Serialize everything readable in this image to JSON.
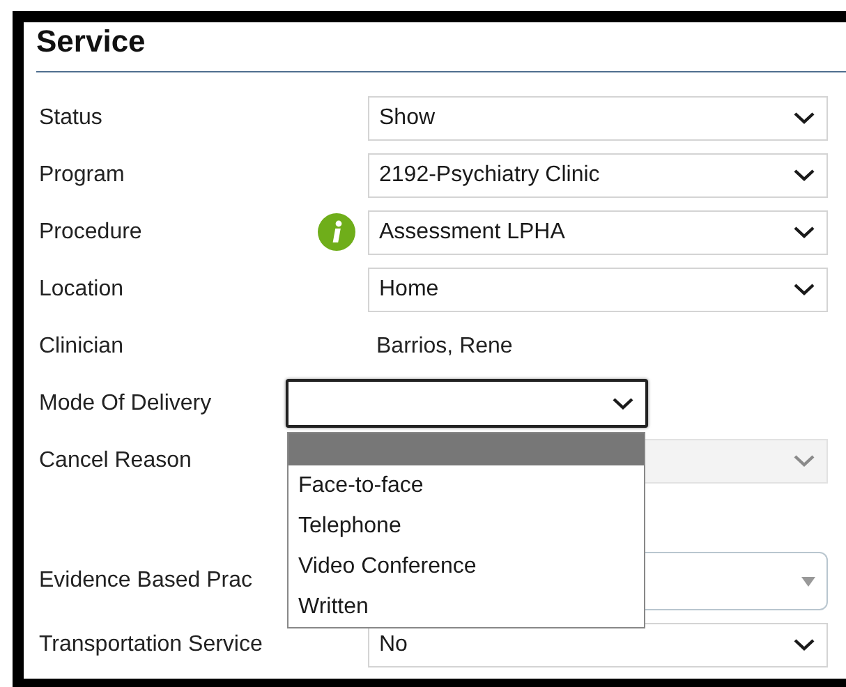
{
  "title": "Service",
  "rows": [
    {
      "label": "Status",
      "kind": "select",
      "value": "Show",
      "open": false,
      "disabled": false
    },
    {
      "label": "Program",
      "kind": "select",
      "value": "2192-Psychiatry Clinic",
      "open": false,
      "disabled": false
    },
    {
      "label": "Procedure",
      "kind": "select",
      "value": "Assessment LPHA",
      "info": true,
      "open": false,
      "disabled": false
    },
    {
      "label": "Location",
      "kind": "select",
      "value": "Home",
      "open": false,
      "disabled": false
    },
    {
      "label": "Clinician",
      "kind": "text",
      "value": "Barrios, Rene"
    },
    {
      "label": "Mode Of Delivery",
      "kind": "select",
      "open": true,
      "disabled": false,
      "options": [
        {
          "selected": true
        },
        {
          "label": "Face-to-face",
          "selected": false
        },
        {
          "label": "Telephone",
          "selected": false
        },
        {
          "label": "Video Conference",
          "selected": false
        },
        {
          "label": "Written",
          "selected": false
        }
      ]
    },
    {
      "label": "Cancel Reason",
      "kind": "select",
      "open": false,
      "disabled": true
    },
    {
      "label": "Evidence Based Prac",
      "kind": "combo"
    },
    {
      "label": "Transportation Service",
      "kind": "select",
      "value": "No",
      "open": false,
      "disabled": false
    }
  ]
}
